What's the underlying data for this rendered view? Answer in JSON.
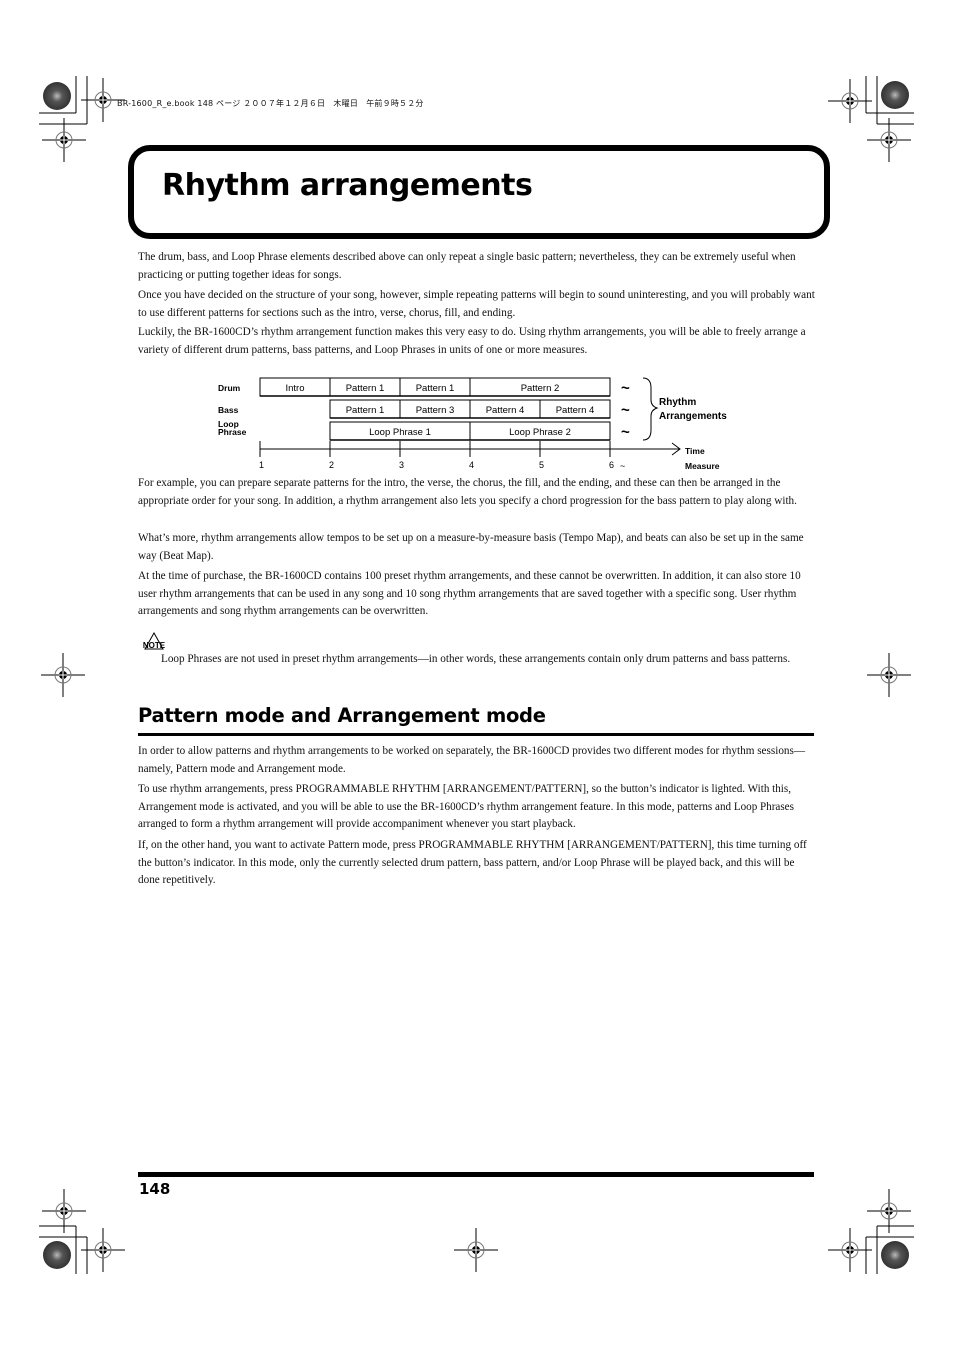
{
  "header_meta": "BR-1600_R_e.book  148 ページ  ２００７年１２月６日　木曜日　午前９時５２分",
  "title": "Rhythm arrangements",
  "intro_paragraphs": [
    "The drum, bass, and Loop Phrase elements described above can only repeat a single basic pattern; nevertheless, they can be extremely useful when practicing or putting together ideas for songs.",
    "Once you have decided on the structure of your song, however, simple repeating patterns will begin to sound uninteresting, and you will probably want to use different patterns for sections such as the intro, verse, chorus, fill, and ending.",
    "Luckily, the BR-1600CD’s rhythm arrangement function makes this very easy to do. Using rhythm arrangements, you will be able to freely arrange a variety of different drum patterns, bass patterns, and Loop Phrases in units of one or more measures."
  ],
  "diagram": {
    "rows": [
      {
        "label": "Drum",
        "blocks": [
          {
            "text": "Intro",
            "start": 1,
            "end": 2
          },
          {
            "text": "Pattern 1",
            "start": 2,
            "end": 3
          },
          {
            "text": "Pattern 1",
            "start": 3,
            "end": 4
          },
          {
            "text": "Pattern 2",
            "start": 4,
            "end": 6
          }
        ]
      },
      {
        "label": "Bass",
        "blocks": [
          {
            "text": "Pattern 1",
            "start": 2,
            "end": 3
          },
          {
            "text": "Pattern 3",
            "start": 3,
            "end": 4
          },
          {
            "text": "Pattern 4",
            "start": 4,
            "end": 5
          },
          {
            "text": "Pattern 4",
            "start": 5,
            "end": 6
          }
        ]
      },
      {
        "label": "Loop\nPhrase",
        "blocks": [
          {
            "text": "Loop Phrase 1",
            "start": 2,
            "end": 4
          },
          {
            "text": "Loop Phrase 2",
            "start": 4,
            "end": 6
          }
        ]
      }
    ],
    "measures": [
      "1",
      "2",
      "3",
      "4",
      "5",
      "6"
    ],
    "continuation": "~",
    "brace_label_line1": "Rhythm",
    "brace_label_line2": "Arrangements",
    "axis_label_time": "Time",
    "axis_label_measure": "Measure"
  },
  "body_paragraphs": [
    "For example, you can prepare separate patterns for the intro, the verse, the chorus, the fill, and the ending, and these can then be arranged in the appropriate order for your song. In addition, a rhythm arrangement also lets you specify a chord progression for the bass pattern to play along with.",
    "What’s more, rhythm arrangements allow tempos to be set up on a measure-by-measure basis (Tempo Map), and beats can also be set up in the same way (Beat Map).",
    "At the time of purchase, the BR-1600CD contains 100 preset rhythm arrangements, and these cannot be overwritten. In addition, it can also store 10 user rhythm arrangements that can be used in any song and 10 song rhythm arrangements that are saved together with a specific song. User rhythm arrangements and song rhythm arrangements can be overwritten."
  ],
  "note": {
    "icon_label": "NOTE",
    "text": "Loop Phrases are not used in preset rhythm arrangements—in other words, these arrangements contain only drum patterns and bass patterns."
  },
  "section2": {
    "heading": "Pattern mode and Arrangement mode",
    "paragraphs": [
      "In order to allow patterns and rhythm arrangements to be worked on separately, the BR-1600CD provides two different modes for rhythm sessions—namely, Pattern mode and Arrangement mode.",
      "To use rhythm arrangements, press PROGRAMMABLE RHYTHM [ARRANGEMENT/PATTERN], so the button’s indicator is lighted. With this, Arrangement mode is activated, and you will be able to use the BR-1600CD’s rhythm arrangement feature. In this mode, patterns and Loop Phrases arranged to form a rhythm arrangement will provide accompaniment whenever you start playback.",
      "If, on the other hand, you want to activate Pattern mode, press PROGRAMMABLE RHYTHM [ARRANGEMENT/PATTERN], this time turning off the button’s indicator. In this mode, only the currently selected drum pattern, bass pattern, and/or Loop Phrase will be played back, and this will be done repetitively."
    ]
  },
  "page_number": "148"
}
